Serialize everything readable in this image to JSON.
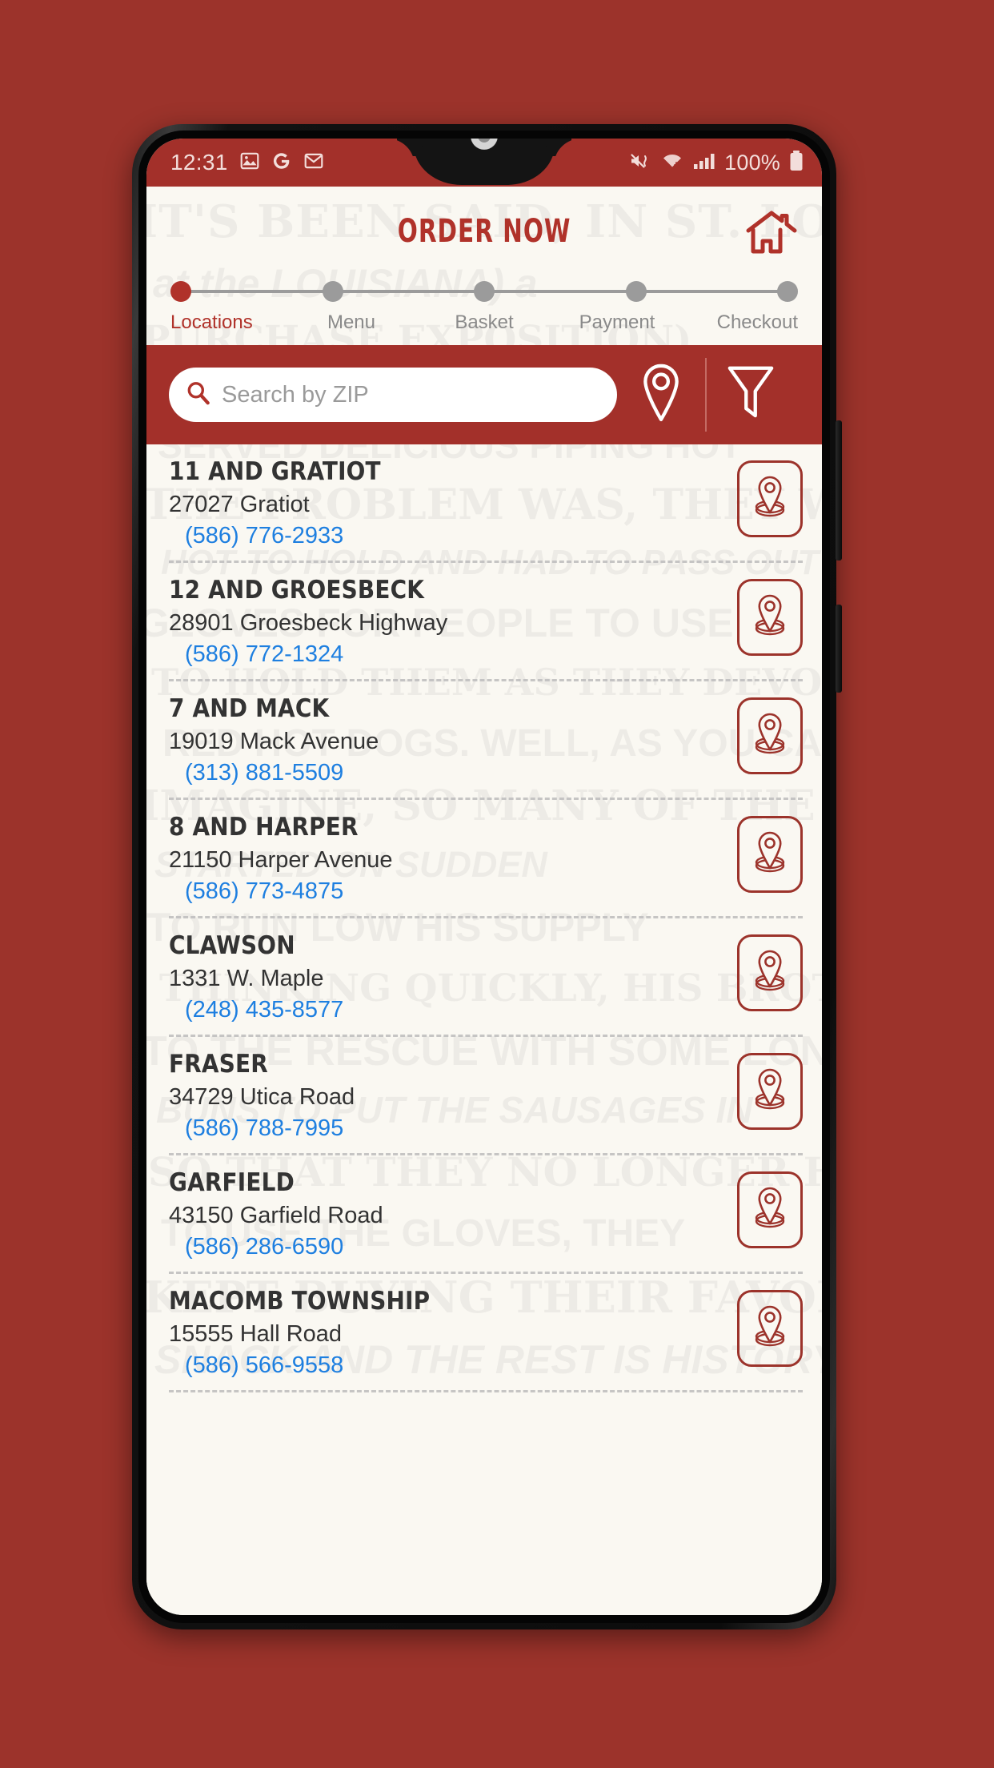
{
  "status_bar": {
    "time": "12:31",
    "battery_percent": "100%",
    "icons": [
      "photos-icon",
      "google-icon",
      "gmail-icon",
      "vibrate-mute-icon",
      "wifi-icon",
      "signal-bars-icon",
      "battery-icon"
    ]
  },
  "header": {
    "title": "ORDER NOW",
    "home_icon": "home-icon"
  },
  "stepper": {
    "steps": [
      {
        "label": "Locations",
        "active": true
      },
      {
        "label": "Menu",
        "active": false
      },
      {
        "label": "Basket",
        "active": false
      },
      {
        "label": "Payment",
        "active": false
      },
      {
        "label": "Checkout",
        "active": false
      }
    ]
  },
  "search": {
    "placeholder": "Search by ZIP",
    "value": "",
    "search_icon": "search-icon",
    "pin_icon": "map-pin-icon",
    "filter_icon": "filter-funnel-icon"
  },
  "locations": [
    {
      "name": "11 AND GRATIOT",
      "address": "27027 Gratiot",
      "phone": "(586) 776-2933"
    },
    {
      "name": "12 AND GROESBECK",
      "address": "28901 Groesbeck Highway",
      "phone": "(586) 772-1324"
    },
    {
      "name": "7 AND MACK",
      "address": "19019 Mack Avenue",
      "phone": "(313) 881-5509"
    },
    {
      "name": "8 AND HARPER",
      "address": "21150 Harper Avenue",
      "phone": "(586) 773-4875"
    },
    {
      "name": "CLAWSON",
      "address": "1331 W. Maple",
      "phone": "(248) 435-8577"
    },
    {
      "name": "FRASER",
      "address": "34729 Utica Road",
      "phone": "(586) 788-7995"
    },
    {
      "name": "GARFIELD",
      "address": "43150 Garfield Road",
      "phone": "(586) 286-6590"
    },
    {
      "name": "MACOMB TOWNSHIP",
      "address": "15555 Hall Road",
      "phone": "(586) 566-9558"
    }
  ],
  "watermark_lines": [
    "IT'S BEEN SAID, IN ST. LOUIS",
    "at the LOUISIANA) a",
    "PURCHASE EXPOSITION)",
    "SERVED DELICIOUS PIPING HOT",
    "THE PROBLEM WAS, THEY WERE TOO",
    "HOT TO HOLD AND HAD TO PASS OUT",
    "GLOVES FOR PEOPLE TO USE",
    "TO HOLD THEM AS THEY DEVOURED THESE",
    "RED HOT DOGS. WELL, AS YOU CAN",
    "IMAGINE, SO MANY OF THE CUSTOMERS",
    "STARTED ON SUDDEN",
    "TO RUN LOW HIS SUPPLY",
    "THINKING QUICKLY, HIS BROTHER-IN-LAW WAS",
    "TO THE RESCUE WITH SOME LONG, SOFT",
    "BUNS TO PUT THE SAUSAGES IN",
    "SO THAT THEY NO LONGER HAD",
    "TO USE THE GLOVES, THEY",
    "KEPT BUYING THEIR FAVORITE",
    "SNACK AND THE REST IS HISTORY"
  ],
  "colors": {
    "brand_red": "#A3302A",
    "accent_red": "#B0322A",
    "page_background": "#9C332B",
    "screen_background": "#FAF8F2",
    "phone_link_blue": "#1E7FE0",
    "inactive_gray": "#9b9b9b"
  }
}
